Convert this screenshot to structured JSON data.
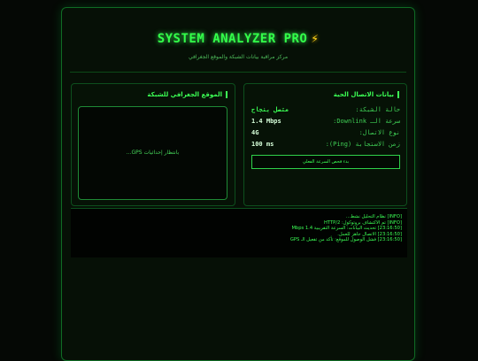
{
  "header": {
    "title": "SYSTEM ANALYZER PRO",
    "bolt_icon": "lightning-bolt-icon",
    "subtitle": "مركز مراقبة بيانات الشبكة والموقع الجغرافي"
  },
  "map_panel": {
    "title": "الموقع الجغرافي للشبكة",
    "waiting_text": "بانتظار إحداثيات GPS..."
  },
  "connection_panel": {
    "title": "بيانات الاتصال الحية",
    "rows": [
      {
        "label": "حالة الشبكة:",
        "value": "متصل بنجاح"
      },
      {
        "label": "سرعة الـ Downlink:",
        "value": "1.4 Mbps"
      },
      {
        "label": "نوع الاتصال:",
        "value": "4G"
      },
      {
        "label": "زمن الاستجابة (Ping):",
        "value": "100 ms"
      }
    ],
    "test_button": "بدء فحص السرعة الفعلي"
  },
  "log": {
    "lines": [
      "[INFO] نظام التحليل نشط...",
      "[INFO] تم الاكتشاف بروتوكول: HTTP/2",
      "[23:16:50] تحديث البيانات: السرعة التقريبية 1.4 Mbps",
      "[23:16:50] الاتصال جاهز للعمل.",
      "[23:16:50] فشل الوصول للموقع: تأكد من تفعيل الـ GPS"
    ]
  },
  "colors": {
    "accent": "#33ff4a",
    "background": "#050805",
    "bolt": "#ffd21a"
  }
}
